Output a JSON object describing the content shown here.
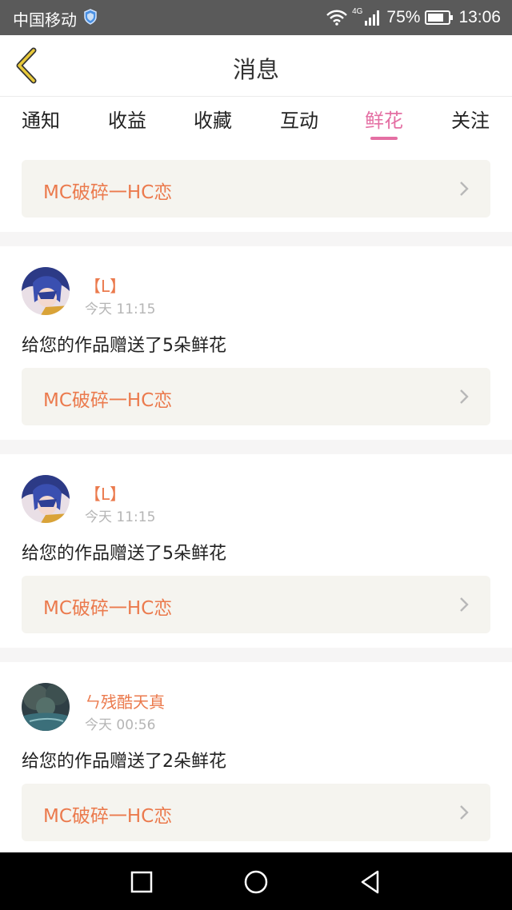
{
  "status_bar": {
    "carrier": "中国移动",
    "network": "4G",
    "battery": "75%",
    "time": "13:06"
  },
  "header": {
    "title": "消息"
  },
  "tabs": [
    {
      "label": "通知"
    },
    {
      "label": "收益"
    },
    {
      "label": "收藏"
    },
    {
      "label": "互动"
    },
    {
      "label": "鲜花",
      "active": true
    },
    {
      "label": "关注"
    }
  ],
  "top_card": {
    "work_title": "MC破碎一HC恋"
  },
  "messages": [
    {
      "username": "【L】",
      "time": "今天 11:15",
      "text": "给您的作品赠送了5朵鲜花",
      "work_title": "MC破碎一HC恋"
    },
    {
      "username": "【L】",
      "time": "今天 11:15",
      "text": "给您的作品赠送了5朵鲜花",
      "work_title": "MC破碎一HC恋"
    },
    {
      "username": "ㄣ残酷天真",
      "time": "今天 00:56",
      "text": "给您的作品赠送了2朵鲜花",
      "work_title": "MC破碎一HC恋"
    }
  ],
  "colors": {
    "accent_pink": "#e46fa3",
    "accent_orange": "#eb7a4d",
    "back_arrow": "#e8c93a"
  },
  "icons": {
    "back": "back-arrow-icon",
    "chevron": "chevron-right-icon",
    "nav_recent": "square-icon",
    "nav_home": "circle-icon",
    "nav_back": "triangle-back-icon"
  }
}
